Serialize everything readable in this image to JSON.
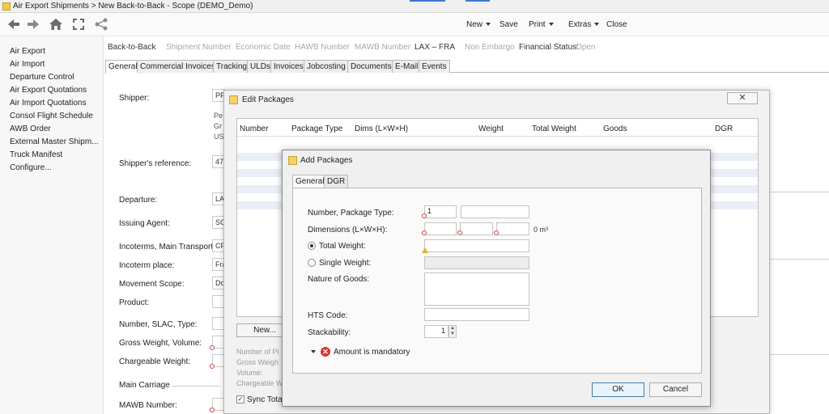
{
  "window": {
    "title": "Air Export Shipments > New Back-to-Back - Scope (DEMO_Demo)"
  },
  "toolbar": {
    "icons": [
      "back-arrow-icon",
      "forward-arrow-icon",
      "home-icon",
      "fullscreen-icon",
      "share-icon"
    ],
    "new_label": "New",
    "save_label": "Save",
    "print_label": "Print",
    "extras_label": "Extras",
    "close_label": "Close"
  },
  "sidebar": {
    "items": [
      {
        "label": "Air Export"
      },
      {
        "label": "Air Import"
      },
      {
        "label": "Departure Control"
      },
      {
        "label": "Air Export Quotations"
      },
      {
        "label": "Air Import Quotations"
      },
      {
        "label": "Consol Flight Schedule"
      },
      {
        "label": "AWB Order"
      },
      {
        "label": "External Master Shipm..."
      },
      {
        "label": "Truck Manifest"
      },
      {
        "label": "Configure..."
      }
    ]
  },
  "header": {
    "type": "Back-to-Back",
    "shipment_number": "Shipment Number",
    "economic_date": "Economic Date",
    "hawb_number": "HAWB Number",
    "mawb_number": "MAWB Number",
    "route": "LAX – FRA",
    "embargo": "Non Embargo",
    "financial_status_label": "Financial Status:",
    "financial_status_value": "Open"
  },
  "tabs": [
    {
      "label": "General"
    },
    {
      "label": "Commercial Invoices"
    },
    {
      "label": "Tracking"
    },
    {
      "label": "ULDs"
    },
    {
      "label": "Invoices"
    },
    {
      "label": "Jobcosting"
    },
    {
      "label": "Documents"
    },
    {
      "label": "E-Mail"
    },
    {
      "label": "Events"
    }
  ],
  "form": {
    "shipper_label": "Shipper:",
    "shipper_value": "PP",
    "shipper_line1": "Pe",
    "shipper_line2": "Gr",
    "shipper_line3": "US",
    "shipper_ref_label": "Shipper's reference:",
    "shipper_ref_value": "47",
    "departure_label": "Departure:",
    "departure_value": "LA",
    "issuing_agent_label": "Issuing Agent:",
    "issuing_agent_value": "SC",
    "incoterms_label": "Incoterms, Main Transport:",
    "incoterms_value": "CF",
    "incoterm_place_label": "Incoterm place:",
    "incoterm_place_value": "Fra",
    "movement_scope_label": "Movement Scope:",
    "movement_scope_value": "Do",
    "product_label": "Product:",
    "number_slac_label": "Number, SLAC, Type:",
    "gross_weight_label": "Gross Weight, Volume:",
    "chargeable_weight_label": "Chargeable Weight:",
    "main_carriage_label": "Main Carriage",
    "mawb_number_label": "MAWB Number:"
  },
  "edit_packages": {
    "title": "Edit Packages",
    "close_symbol": "✕",
    "columns": [
      "Number",
      "Package Type",
      "Dims (L×W×H)",
      "Weight",
      "Total Weight",
      "Goods",
      "DGR"
    ],
    "new_button": "New...",
    "summary_number": "Number of Pi",
    "summary_gross": "Gross Weigh",
    "summary_volume": "Volume:",
    "summary_chargeable": "Chargeable W",
    "sync_label": "Sync Total"
  },
  "add_packages": {
    "title": "Add Packages",
    "tabs": [
      {
        "label": "General"
      },
      {
        "label": "DGR"
      }
    ],
    "number_label": "Number, Package Type:",
    "number_value": "1",
    "dimensions_label": "Dimensions (L×W×H):",
    "volume_unit": "0 m³",
    "total_weight_label": "Total Weight:",
    "single_weight_label": "Single Weight:",
    "nature_label": "Nature of Goods:",
    "hts_label": "HTS Code:",
    "stackability_label": "Stackability:",
    "stackability_value": "1",
    "error_message": "Amount is mandatory",
    "ok_button": "OK",
    "cancel_button": "Cancel"
  }
}
